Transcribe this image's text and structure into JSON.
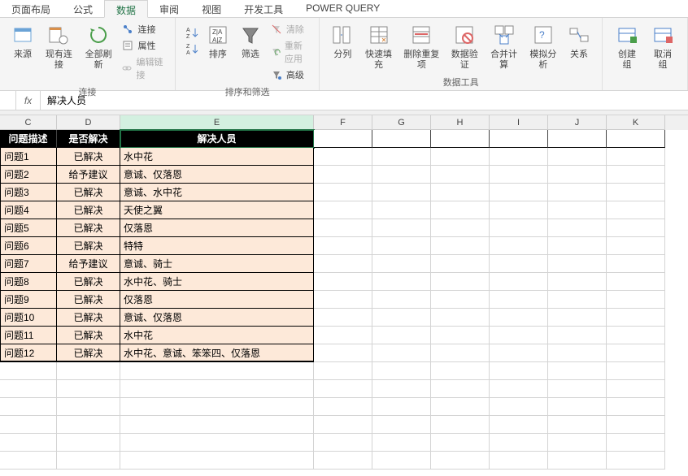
{
  "tabs": {
    "layout": "页面布局",
    "formula": "公式",
    "data": "数据",
    "review": "审阅",
    "view": "视图",
    "developer": "开发工具",
    "powerquery": "POWER QUERY"
  },
  "ribbon": {
    "source": "来源",
    "existing_conn": "现有连接",
    "refresh_all": "全部刷新",
    "connections": "连接",
    "properties": "属性",
    "edit_links": "编辑链接",
    "group_conn": "连接",
    "sort_az_btn": "A→Z",
    "sort": "排序",
    "filter": "筛选",
    "clear": "清除",
    "reapply": "重新应用",
    "advanced": "高级",
    "group_sortfilter": "排序和筛选",
    "text_to_col": "分列",
    "flash_fill": "快速填充",
    "remove_dup": "删除重复项",
    "data_val": "数据验证",
    "consolidate": "合并计算",
    "whatif": "模拟分析",
    "relations": "关系",
    "group_datatools": "数据工具",
    "group_create": "创建组",
    "ungroup": "取消组"
  },
  "formula_bar": {
    "value": "解决人员"
  },
  "columns": [
    "C",
    "D",
    "E",
    "F",
    "G",
    "H",
    "I",
    "J",
    "K"
  ],
  "headers": {
    "c": "问题描述",
    "d": "是否解决",
    "e": "解决人员"
  },
  "rows": [
    {
      "c": "问题1",
      "d": "已解决",
      "e": "水中花"
    },
    {
      "c": "问题2",
      "d": "给予建议",
      "e": "意诚、仅落恩"
    },
    {
      "c": "问题3",
      "d": "已解决",
      "e": "意诚、水中花"
    },
    {
      "c": "问题4",
      "d": "已解决",
      "e": "天使之翼"
    },
    {
      "c": "问题5",
      "d": "已解决",
      "e": "仅落恩"
    },
    {
      "c": "问题6",
      "d": "已解决",
      "e": "特特"
    },
    {
      "c": "问题7",
      "d": "给予建议",
      "e": "意诚、骑士"
    },
    {
      "c": "问题8",
      "d": "已解决",
      "e": "水中花、骑士"
    },
    {
      "c": "问题9",
      "d": "已解决",
      "e": "仅落恩"
    },
    {
      "c": "问题10",
      "d": "已解决",
      "e": "意诚、仅落恩"
    },
    {
      "c": "问题11",
      "d": "已解决",
      "e": "水中花"
    },
    {
      "c": "问题12",
      "d": "已解决",
      "e": "水中花、意诚、笨笨四、仅落恩"
    }
  ]
}
